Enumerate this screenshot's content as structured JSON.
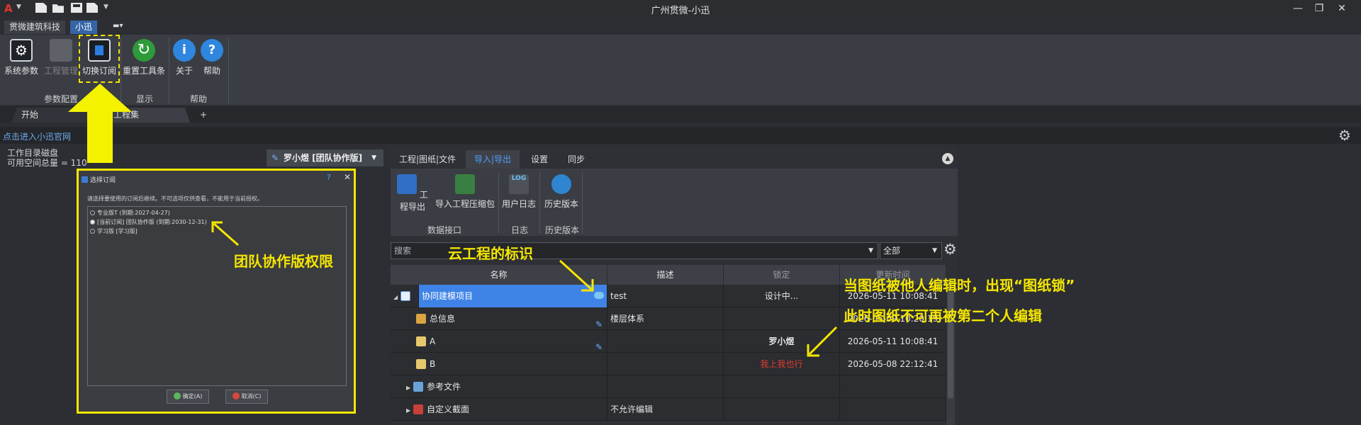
{
  "titlebar": {
    "app_logo": "A",
    "title": "广州贯微-小迅",
    "icons": [
      "new-file-icon",
      "open-folder-icon",
      "save-icon",
      "save-as-icon"
    ],
    "window_buttons": [
      "minimize",
      "restore",
      "close"
    ]
  },
  "ribbon_tabs": [
    "贯微建筑科技",
    "小迅"
  ],
  "ribbon": {
    "buttons": [
      {
        "label": "系统参数",
        "icon": "system-settings-icon"
      },
      {
        "label": "工程管理",
        "icon": "project-manager-icon",
        "disabled": true
      },
      {
        "label": "切换订阅",
        "icon": "subscription-icon"
      },
      {
        "label": "重置工具条",
        "icon": "reset-icon"
      },
      {
        "label": "关于",
        "icon": "info-icon"
      },
      {
        "label": "帮助",
        "icon": "help-icon"
      }
    ],
    "groups": [
      "参数配置",
      "显示",
      "帮助"
    ]
  },
  "doc_tabs": [
    "开始",
    "工程集",
    "+"
  ],
  "linkbar": {
    "link": "点击进入小迅官网"
  },
  "left_info": {
    "line1": "工作目录磁盘",
    "line2": "可用空间总量 = 110",
    "user": "罗小煜 [团队协作版]"
  },
  "dialog": {
    "title": "选择订阅",
    "hint": "请选择要使用的订阅后继续。不可选项仅供查看，不能用于当前授权。",
    "options": [
      {
        "label": "专业版T (到期:2027-04-27)",
        "selected": false
      },
      {
        "label": "[当前订阅] 团队协作版 (到期:2030-12-31)",
        "selected": true
      },
      {
        "label": "学习版 [学习版]",
        "selected": false
      }
    ],
    "ok": "确定(A)",
    "cancel": "取消(C)"
  },
  "annotations": {
    "team_perm": "团队协作版权限",
    "cloud_mark": "云工程的标识",
    "lock_line1": "当图纸被他人编辑时，出现“图纸锁”",
    "lock_line2": "此时图纸不可再被第二个人编辑"
  },
  "panel": {
    "tabs": [
      "工程|图纸|文件",
      "导入|导出",
      "设置",
      "同步"
    ],
    "buttons": [
      {
        "label": "工程导出"
      },
      {
        "label": "导入工程压缩包"
      },
      {
        "label": "用户日志",
        "icon_text": "LOG"
      },
      {
        "label": "历史版本"
      }
    ],
    "groups": [
      "数据接口",
      "日志",
      "历史版本"
    ],
    "search_placeholder": "搜索",
    "filter": "全部"
  },
  "grid": {
    "headers": [
      "名称",
      "描述",
      "锁定",
      "更新时间"
    ],
    "rows": [
      {
        "name": "协同建模项目",
        "desc": "test",
        "lock": "设计中...",
        "time": "2026-05-11 10:08:41"
      },
      {
        "name": "总信息",
        "desc": "楼层体系",
        "lock": "",
        "time": "2026-05-09 10:20:19"
      },
      {
        "name": "A",
        "desc": "",
        "lock": "罗小煜",
        "time": "2026-05-11 10:08:41"
      },
      {
        "name": "B",
        "desc": "",
        "lock": "我上我也行",
        "time": "2026-05-08 22:12:41"
      },
      {
        "name": "参考文件",
        "desc": "",
        "lock": "",
        "time": ""
      },
      {
        "name": "自定义截面",
        "desc": "不允许编辑",
        "lock": "",
        "time": ""
      }
    ]
  }
}
